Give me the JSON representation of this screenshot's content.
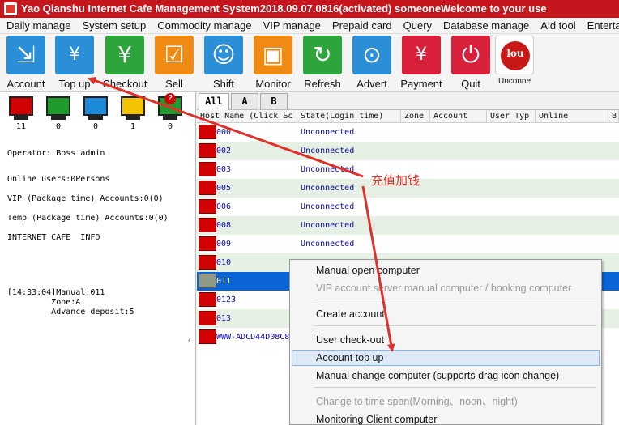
{
  "title": "Yao Qianshu Internet Cafe Management System2018.09.07.0816(activated)  someoneWelcome to your use",
  "menu": [
    "Daily manage",
    "System setup",
    "Commodity manage",
    "VIP manage",
    "Prepaid card",
    "Query",
    "Database manage",
    "Aid tool",
    "Entertai"
  ],
  "toolbar": [
    {
      "label": "Account",
      "icon": "account-icon",
      "color": "#2a8fd6"
    },
    {
      "label": "Top up",
      "icon": "top-up-icon",
      "color": "#2a8fd6"
    },
    {
      "label": "Checkout",
      "icon": "checkout-icon",
      "color": "#2ea43c"
    },
    {
      "label": "Sell",
      "icon": "cart-icon",
      "color": "#f08a12"
    },
    {
      "label": "Shift",
      "icon": "shift-icon",
      "color": "#2a8fd6"
    },
    {
      "label": "Monitor",
      "icon": "monitor-icon",
      "color": "#f08a12"
    },
    {
      "label": "Refresh",
      "icon": "refresh-icon",
      "color": "#2ea43c"
    },
    {
      "label": "Advert",
      "icon": "advert-icon",
      "color": "#2a8fd6"
    },
    {
      "label": "Payment",
      "icon": "payment-icon",
      "color": "#d8203a"
    },
    {
      "label": "Quit",
      "icon": "quit-icon",
      "color": "#d8203a"
    },
    {
      "label": "Unconne",
      "icon": "cloud-icon",
      "color": "#c81818",
      "badge": "lou"
    }
  ],
  "status_monitors": [
    {
      "count": "11",
      "color": "#d30000"
    },
    {
      "count": "0",
      "color": "#1e9a2c"
    },
    {
      "count": "0",
      "color": "#1c8ad8"
    },
    {
      "count": "1",
      "color": "#f4c400"
    },
    {
      "count": "0",
      "color": "#1e9a2c",
      "badge": "?"
    }
  ],
  "info": {
    "operator": "Operator: Boss admin",
    "online": "Online users:0Persons",
    "vip": "VIP (Package time) Accounts:0(0)",
    "temp": "Temp (Package time) Accounts:0(0)",
    "cafe": "INTERNET CAFE  INFO",
    "log": "[14:33:04]Manual:011\n         Zone:A\n         Advance deposit:5"
  },
  "tabs": [
    "All",
    "A",
    "B"
  ],
  "columns": [
    "Host Name (Click Sc",
    "State(Login time)",
    "Zone",
    "Account",
    "User Typ",
    "Online",
    "B"
  ],
  "rows": [
    {
      "host": "000",
      "state": "Unconnected"
    },
    {
      "host": "002",
      "state": "Unconnected"
    },
    {
      "host": "003",
      "state": "Unconnected"
    },
    {
      "host": "005",
      "state": "Unconnected"
    },
    {
      "host": "006",
      "state": "Unconnected"
    },
    {
      "host": "008",
      "state": "Unconnected"
    },
    {
      "host": "009",
      "state": "Unconnected"
    },
    {
      "host": "010",
      "state": ""
    },
    {
      "host": "011",
      "state": ""
    },
    {
      "host": "0123",
      "state": ""
    },
    {
      "host": "013",
      "state": ""
    },
    {
      "host": "WWW-ADCD44D08C8",
      "state": ""
    }
  ],
  "context_menu": [
    {
      "label": "Manual open computer",
      "enabled": true
    },
    {
      "label": "VIP account server manual computer / booking computer",
      "enabled": false
    },
    {
      "label": "Create account",
      "enabled": true
    },
    {
      "label": "User check-out",
      "enabled": true
    },
    {
      "label": "Account top up",
      "enabled": true,
      "highlighted": true
    },
    {
      "label": "Manual change computer (supports drag icon change)",
      "enabled": true
    },
    {
      "label": "Change to time span(Morning、noon、night)",
      "enabled": false
    },
    {
      "label": "Monitoring Client computer",
      "enabled": true
    }
  ],
  "annotation": "充值加钱",
  "annotation_color": "#e0302a"
}
